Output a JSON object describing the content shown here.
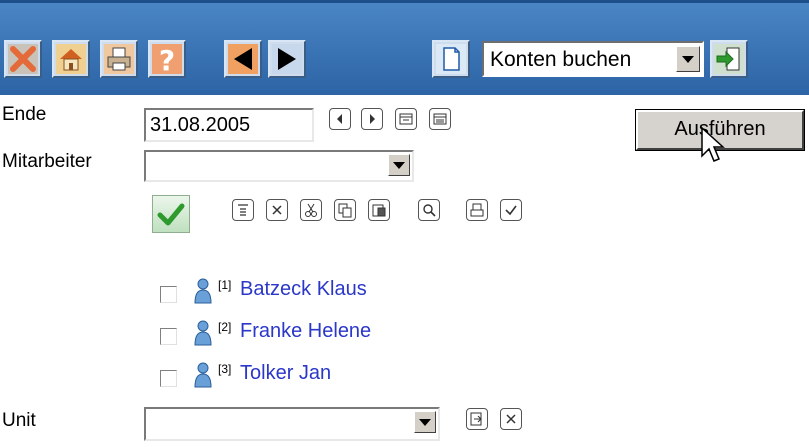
{
  "toolbar": {
    "icons": [
      "close-icon",
      "home-icon",
      "print-icon",
      "help-icon",
      "back-arrow-icon",
      "forward-arrow-icon",
      "document-icon",
      "go-icon"
    ],
    "mode_select_value": "Konten buchen",
    "help_glyph": "?"
  },
  "form": {
    "ende_label": "Ende",
    "ende_value": "31.08.2005",
    "mitarbeiter_label": "Mitarbeiter",
    "mitarbeiter_value": "",
    "unit_label": "Unit",
    "unit_value": "",
    "run_button_label": "Ausführen"
  },
  "employees": [
    {
      "index": "[1]",
      "name": "Batzeck Klaus",
      "checked": false
    },
    {
      "index": "[2]",
      "name": "Franke Helene",
      "checked": false
    },
    {
      "index": "[3]",
      "name": "Tolker Jan",
      "checked": false
    }
  ],
  "colors": {
    "toolbar_blue": "#3a74b8",
    "link_blue": "#2a37c8",
    "check_green": "#2e9a2e"
  }
}
